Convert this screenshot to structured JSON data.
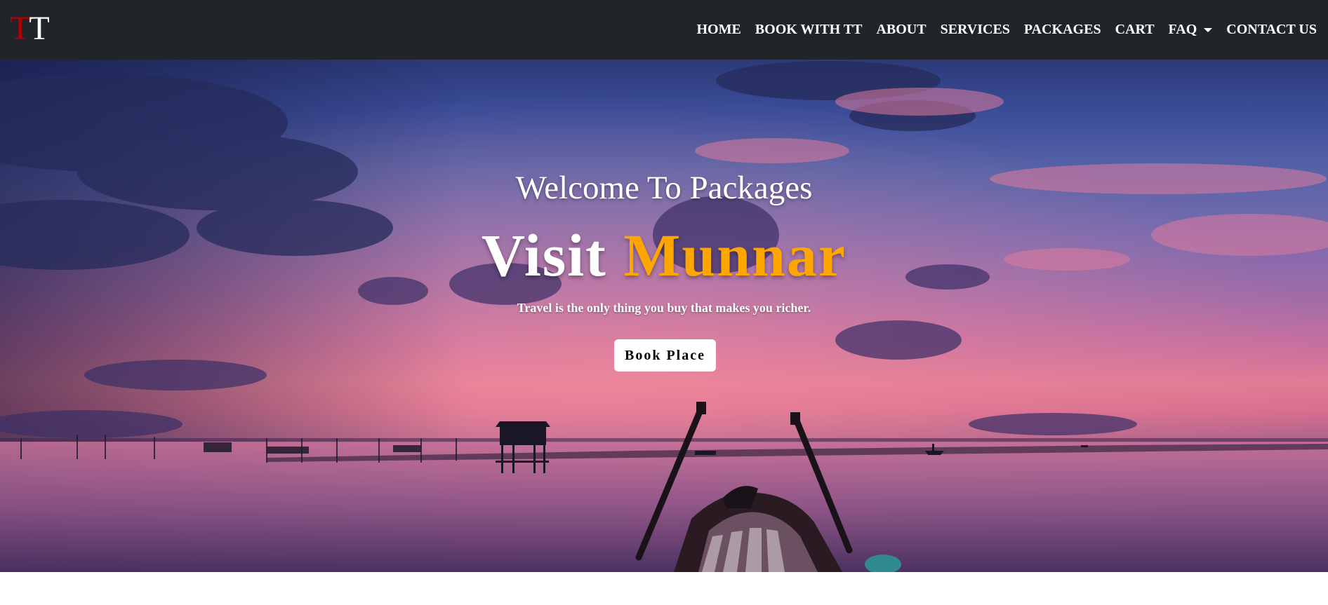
{
  "brand": {
    "letter1": "T",
    "letter2": "T",
    "color1": "#b30000",
    "color2": "#ffffff"
  },
  "nav": {
    "items": [
      {
        "label": "HOME"
      },
      {
        "label": "BOOK WITH TT"
      },
      {
        "label": "ABOUT"
      },
      {
        "label": "SERVICES"
      },
      {
        "label": "PACKAGES"
      },
      {
        "label": "CART"
      },
      {
        "label": "FAQ",
        "dropdown": true,
        "icon": "caret-down-icon"
      },
      {
        "label": "CONTACT US"
      }
    ]
  },
  "hero": {
    "welcome": "Welcome To Packages",
    "headline_prefix": "Visit",
    "headline_accent": "Munnar",
    "accent_color": "#ffa500",
    "tagline": "Travel is the only thing you buy that makes you richer.",
    "button_label": "Book Place"
  },
  "colors": {
    "navbar_bg": "#212529",
    "nav_text": "#ffffff",
    "button_bg": "#ffffff",
    "button_text": "#000000"
  }
}
